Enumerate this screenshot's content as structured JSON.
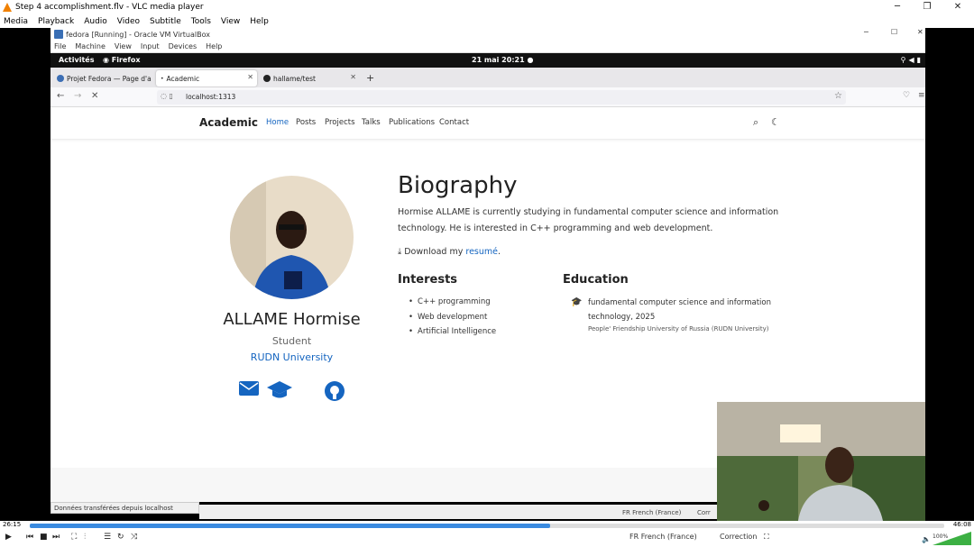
{
  "vlc": {
    "title": "Step 4 accomplishment.flv - VLC media player",
    "menu": [
      "Media",
      "Playback",
      "Audio",
      "Video",
      "Subtitle",
      "Tools",
      "View",
      "Help"
    ],
    "elapsed": "26:15",
    "total": "46:08",
    "progress": 0.569,
    "volume": "100%",
    "lang": "FR French (France)",
    "correction": "Correction"
  },
  "vbox": {
    "title": "fedora [Running] - Oracle VM VirtualBox",
    "menu": [
      "File",
      "Machine",
      "View",
      "Input",
      "Devices",
      "Help"
    ]
  },
  "gnome": {
    "activities": "Activités",
    "app": "Firefox",
    "clock": "21 mai  20:21"
  },
  "firefox": {
    "tabs": [
      {
        "label": "Projet Fedora — Page d'a"
      },
      {
        "label": "Academic"
      },
      {
        "label": "hallame/test"
      }
    ],
    "url": "localhost:1313",
    "status": "Données transférées depuis localhost"
  },
  "site": {
    "brand": "Academic",
    "nav": [
      "Home",
      "Posts",
      "Projects",
      "Talks",
      "Publications",
      "Contact"
    ]
  },
  "profile": {
    "name": "ALLAME Hormise",
    "role": "Student",
    "org": "RUDN University"
  },
  "bio": {
    "title": "Biography",
    "text": "Hormise ALLAME is currently studying in fundamental computer science and information technology. He is interested in C++ programming and web development.",
    "download_prefix": "Download my ",
    "download_link": "resumé",
    "download_suffix": "."
  },
  "interests": {
    "heading": "Interests",
    "items": [
      "C++ programming",
      "Web development",
      "Artificial Intelligence"
    ]
  },
  "education": {
    "heading": "Education",
    "course": "fundamental computer science and information technology, 2025",
    "institution": "People' Friendship University of Russia (RUDN University)"
  },
  "inner_status": {
    "lang": "FR French (France)",
    "corr": "Corr"
  }
}
